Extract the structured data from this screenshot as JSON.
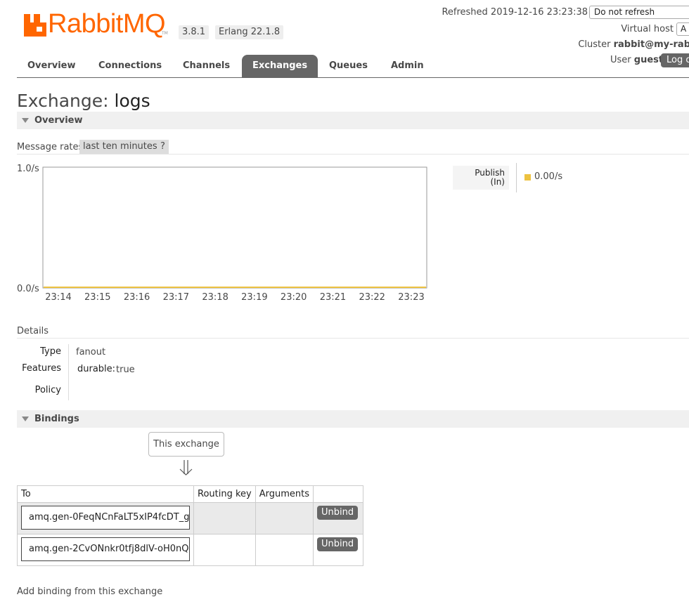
{
  "header": {
    "logo_text": "RabbitMQ",
    "logo_tm": "TM",
    "version": "3.8.1",
    "erlang": "Erlang 22.1.8",
    "refreshed_label": "Refreshed 2019-12-16 23:23:38",
    "refresh_select_value": "Do not refresh",
    "vhost_label": "Virtual host",
    "vhost_select_value": "A",
    "cluster_label": "Cluster",
    "cluster_name": "rabbit@my-rab",
    "user_label": "User",
    "user_name": "guest",
    "logout_label": "Log o",
    "brand_color": "#ff6600"
  },
  "tabs": [
    {
      "label": "Overview",
      "active": false
    },
    {
      "label": "Connections",
      "active": false
    },
    {
      "label": "Channels",
      "active": false
    },
    {
      "label": "Exchanges",
      "active": true
    },
    {
      "label": "Queues",
      "active": false
    },
    {
      "label": "Admin",
      "active": false
    }
  ],
  "page": {
    "title_prefix": "Exchange:",
    "title_name": "logs"
  },
  "overview": {
    "section_label": "Overview",
    "rates_label": "Message rates",
    "rates_range": "last ten minutes",
    "help_label": "?"
  },
  "chart_data": {
    "type": "line",
    "title": "",
    "xlabel": "",
    "ylabel": "",
    "ylim": [
      0,
      1
    ],
    "y_tick_labels": [
      "1.0/s",
      "0.0/s"
    ],
    "x": [
      "23:14",
      "23:15",
      "23:16",
      "23:17",
      "23:18",
      "23:19",
      "23:20",
      "23:21",
      "23:22",
      "23:23"
    ],
    "series": [
      {
        "name": "Publish (In)",
        "values": [
          0,
          0,
          0,
          0,
          0,
          0,
          0,
          0,
          0,
          0
        ],
        "color": "#edc240"
      }
    ],
    "grid": false,
    "legend": "right"
  },
  "legend": {
    "label_line1": "Publish",
    "label_line2": "(In)",
    "value": "0.00/s"
  },
  "details": {
    "section_label": "Details",
    "type_key": "Type",
    "type_value": "fanout",
    "features_key": "Features",
    "features_name": "durable:",
    "features_value": "true",
    "policy_key": "Policy"
  },
  "bindings": {
    "section_label": "Bindings",
    "source_label": "This exchange",
    "columns": [
      "To",
      "Routing key",
      "Arguments",
      ""
    ],
    "rows": [
      {
        "to": "amq.gen-0FeqNCnFaLT5xIP4fcDT_g",
        "routing_key": "",
        "arguments": "",
        "action": "Unbind"
      },
      {
        "to": "amq.gen-2CvONnkr0tfj8dlV-oH0nQ",
        "routing_key": "",
        "arguments": "",
        "action": "Unbind"
      }
    ],
    "add_binding_label": "Add binding from this exchange"
  }
}
